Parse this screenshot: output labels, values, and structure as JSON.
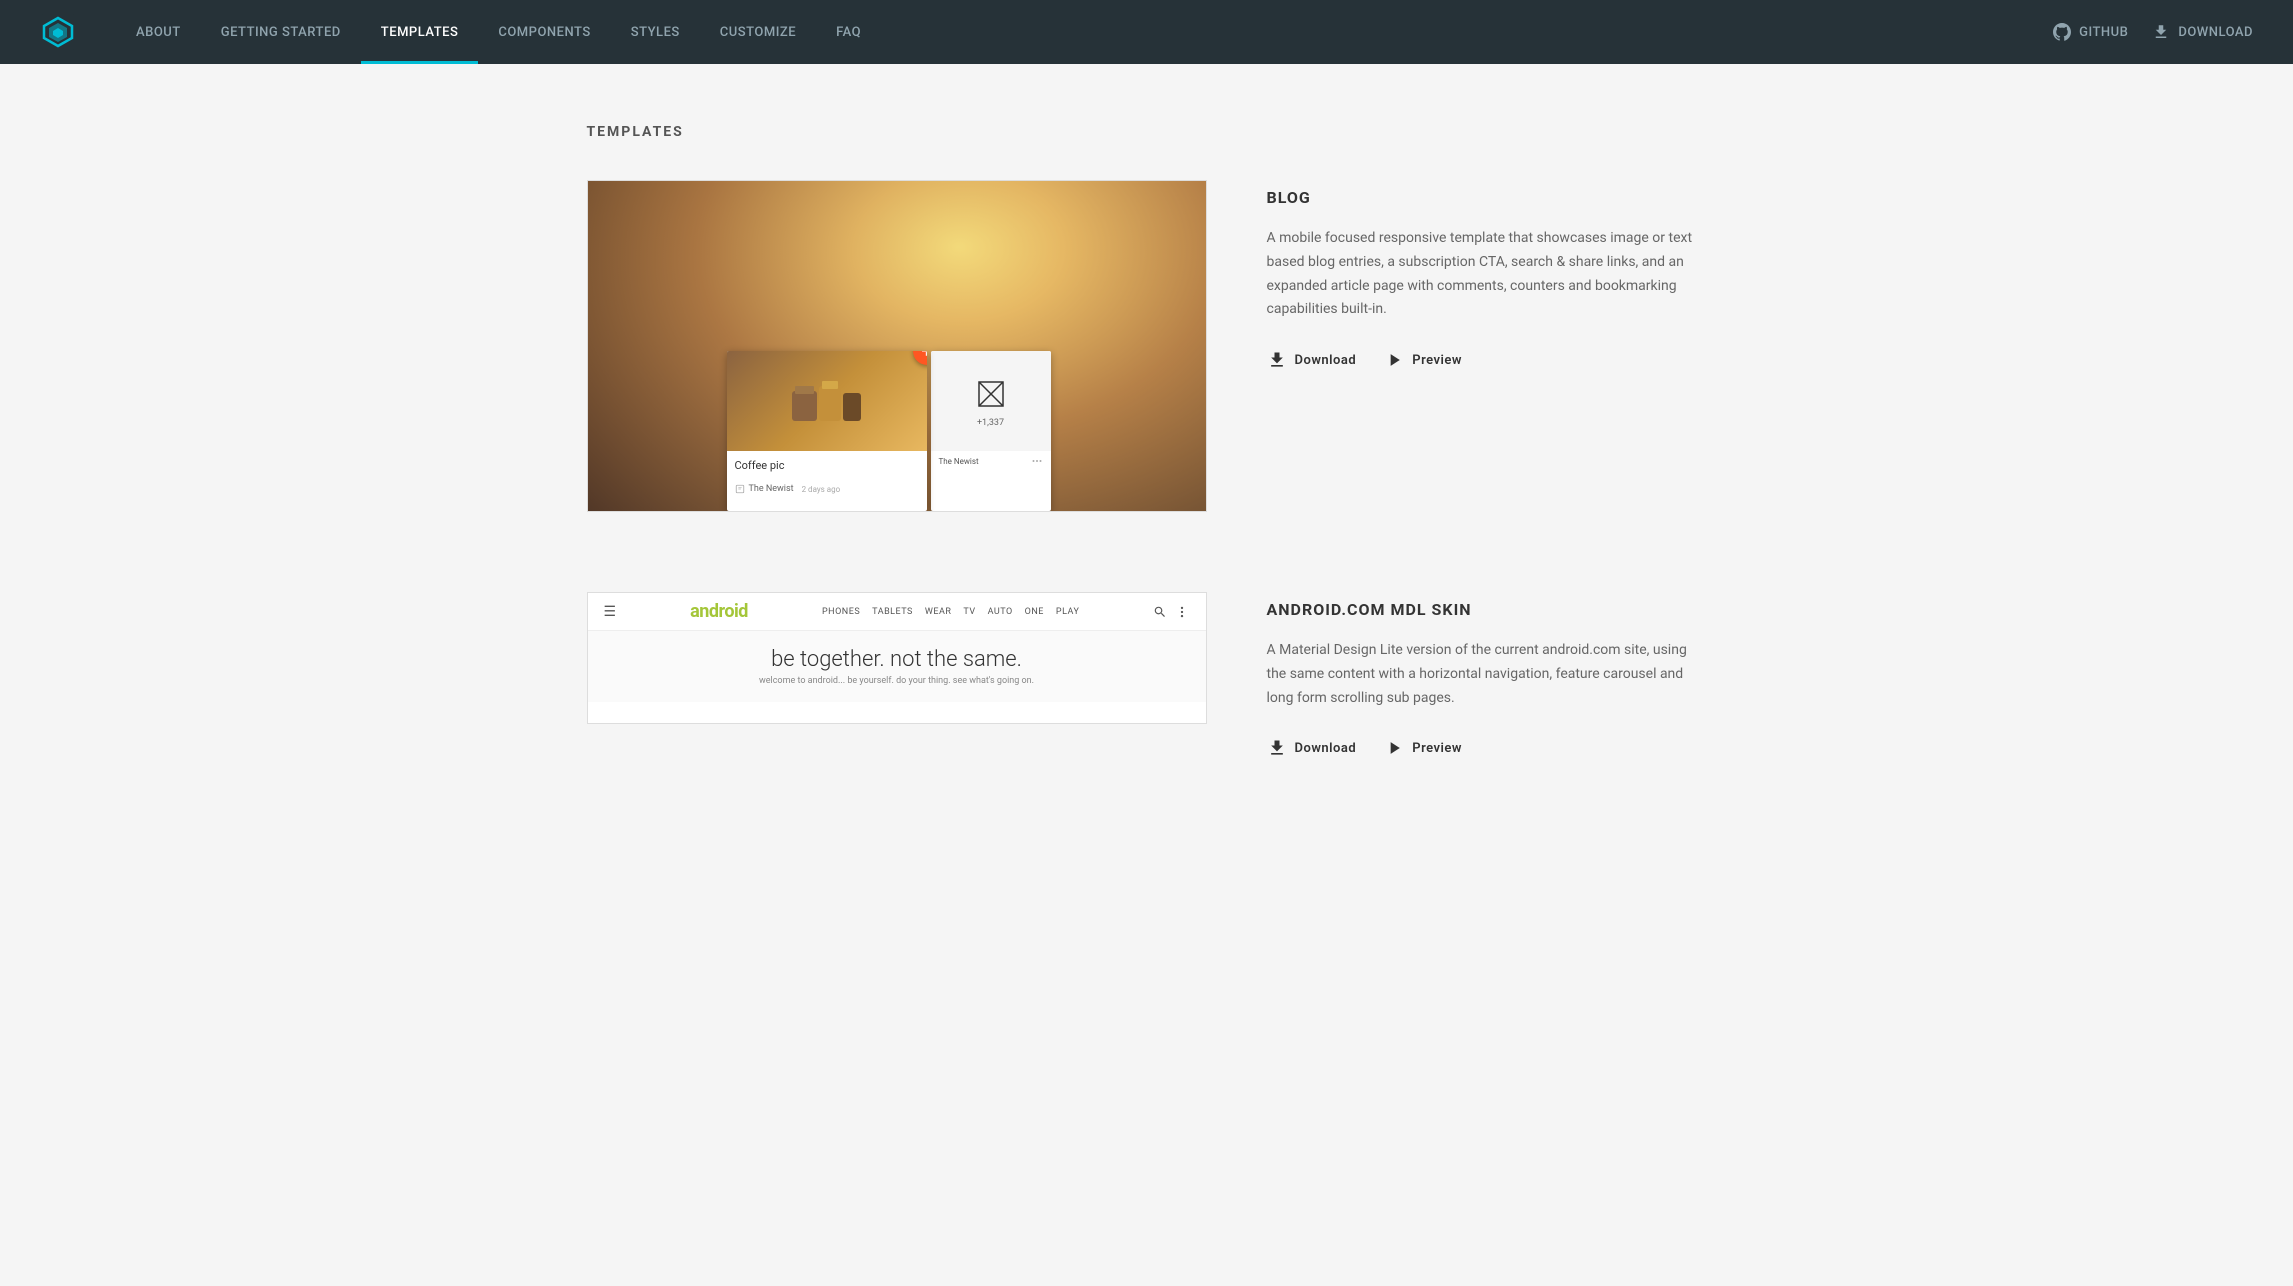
{
  "header": {
    "logo_alt": "MDL Logo",
    "nav_items": [
      {
        "label": "ABOUT",
        "active": false,
        "id": "about"
      },
      {
        "label": "GETTING STARTED",
        "active": false,
        "id": "getting-started"
      },
      {
        "label": "TEMPLATES",
        "active": true,
        "id": "templates"
      },
      {
        "label": "COMPONENTS",
        "active": false,
        "id": "components"
      },
      {
        "label": "STYLES",
        "active": false,
        "id": "styles"
      },
      {
        "label": "CUSTOMIZE",
        "active": false,
        "id": "customize"
      },
      {
        "label": "FAQ",
        "active": false,
        "id": "faq"
      }
    ],
    "github_label": "GitHub",
    "download_label": "Download"
  },
  "main": {
    "page_title": "TEMPLATES",
    "templates": [
      {
        "id": "blog",
        "title": "BLOG",
        "description": "A mobile focused responsive template that showcases image or text based blog entries, a subscription CTA, search & share links, and an expanded article page with comments, counters and bookmarking capabilities built-in.",
        "download_label": "Download",
        "preview_label": "Preview",
        "card_caption": "Coffee pic",
        "card_count": "+1,337",
        "card_footer": "The Newist",
        "card_date": "2 days ago"
      },
      {
        "id": "android",
        "title": "ANDROID.COM MDL SKIN",
        "description": "A Material Design Lite version of the current android.com site, using the same content with a horizontal navigation, feature carousel and long form scrolling sub pages.",
        "download_label": "Download",
        "preview_label": "Preview",
        "android_logo": "android",
        "android_tagline": "be together. not the same.",
        "android_sub": "welcome to android... be yourself. do your thing. see what's going on.",
        "android_nav": [
          "PHONES",
          "TABLETS",
          "WEAR",
          "TV",
          "AUTO",
          "ONE",
          "PLAY"
        ]
      }
    ]
  }
}
